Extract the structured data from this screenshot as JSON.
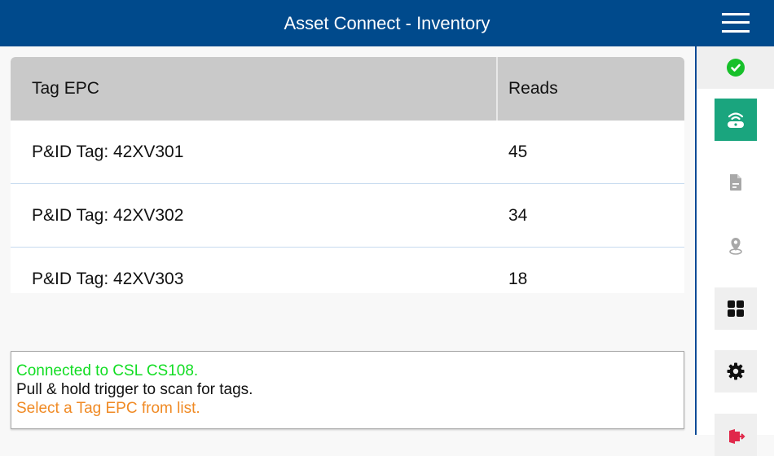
{
  "header": {
    "title": "Asset Connect - Inventory",
    "menu_icon": "hamburger-menu-icon"
  },
  "table": {
    "columns": [
      "Tag EPC",
      "Reads"
    ],
    "rows": [
      {
        "tag": "P&ID Tag: 42XV301",
        "reads": "45"
      },
      {
        "tag": "P&ID Tag: 42XV302",
        "reads": "34"
      },
      {
        "tag": "P&ID Tag: 42XV303",
        "reads": "18"
      }
    ]
  },
  "status": {
    "lines": [
      {
        "text": "Connected to CSL CS108.",
        "color": "#11dd22"
      },
      {
        "text": "Pull & hold trigger to scan for tags.",
        "color": "#111111"
      },
      {
        "text": "Select a Tag EPC from list.",
        "color": "#f08a24"
      }
    ]
  },
  "sidebar": {
    "connection_icon": "check-circle-icon",
    "connection_color": "#17c02a",
    "items": [
      {
        "icon": "rfid-reader-icon",
        "active": true,
        "color": "#1aa57e"
      },
      {
        "icon": "document-icon",
        "active": false
      },
      {
        "icon": "location-pin-icon",
        "active": false
      },
      {
        "icon": "grid-apps-icon",
        "active": false
      },
      {
        "icon": "gear-icon",
        "active": false
      },
      {
        "icon": "exit-icon",
        "active": false,
        "color": "#e0284a"
      }
    ]
  },
  "colors": {
    "header_bg": "#004a8c",
    "table_header_bg": "#c9c9c9",
    "accent": "#1aa57e"
  }
}
